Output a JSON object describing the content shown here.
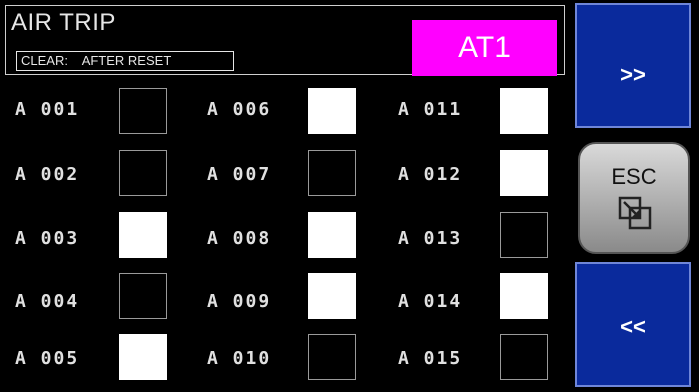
{
  "header": {
    "title": "AIR TRIP",
    "clear_text": "CLEAR:    AFTER RESET",
    "badge": "AT1"
  },
  "rows": [
    [
      {
        "label": "A 001",
        "on": false
      },
      {
        "label": "A 006",
        "on": true
      },
      {
        "label": "A 011",
        "on": true
      }
    ],
    [
      {
        "label": "A 002",
        "on": false
      },
      {
        "label": "A 007",
        "on": false
      },
      {
        "label": "A 012",
        "on": true
      }
    ],
    [
      {
        "label": "A 003",
        "on": true
      },
      {
        "label": "A 008",
        "on": true
      },
      {
        "label": "A 013",
        "on": false
      }
    ],
    [
      {
        "label": "A 004",
        "on": false
      },
      {
        "label": "A 009",
        "on": true
      },
      {
        "label": "A 014",
        "on": true
      }
    ],
    [
      {
        "label": "A 005",
        "on": true
      },
      {
        "label": "A 010",
        "on": false
      },
      {
        "label": "A 015",
        "on": false
      }
    ]
  ],
  "buttons": {
    "next": ">>",
    "prev": "<<",
    "esc": "ESC"
  },
  "colors": {
    "badge": "#ff00ff",
    "nav": "#0a2a9c"
  },
  "icons": {
    "esc_icon": "window-stack-icon"
  }
}
